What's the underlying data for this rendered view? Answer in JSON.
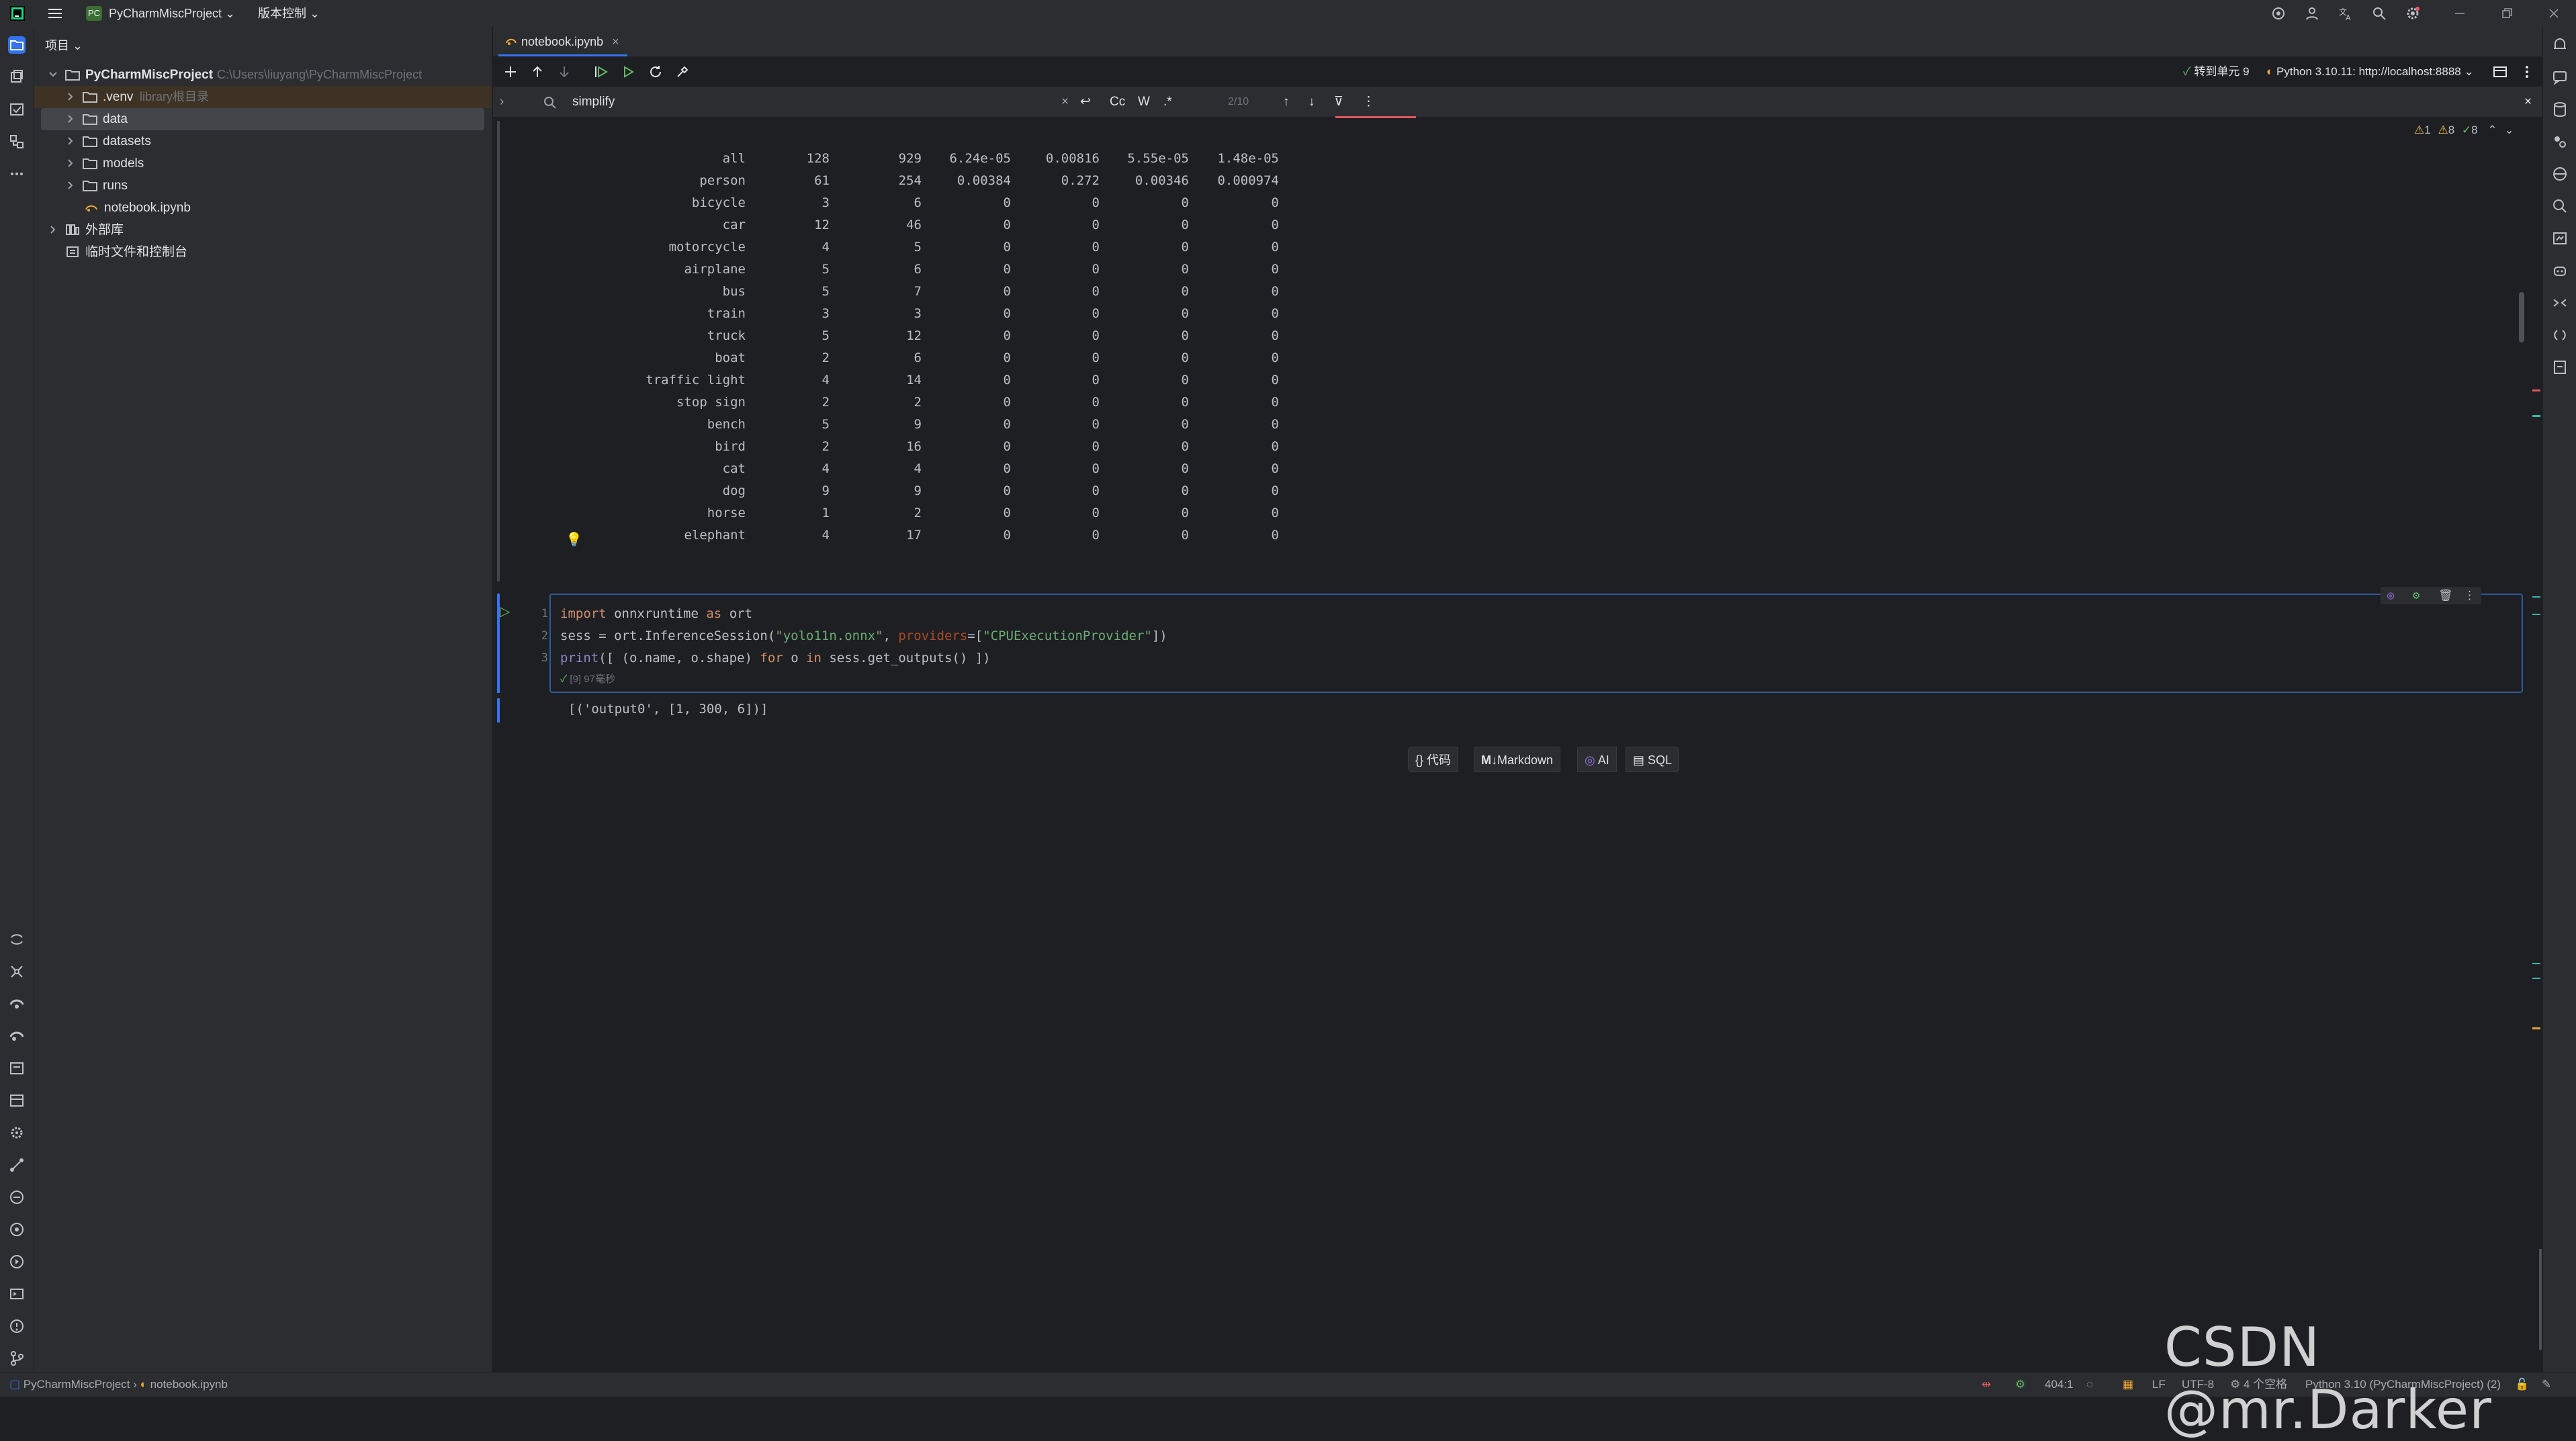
{
  "titlebar": {
    "project_badge": "PC",
    "project_name": "PyCharmMiscProject",
    "vcs_menu": "版本控制"
  },
  "project_panel": {
    "header": "项目",
    "tree": [
      {
        "label": "PyCharmMiscProject",
        "hint": "C:\\Users\\liuyang\\PyCharmMiscProject"
      },
      {
        "label": ".venv",
        "hint": "library根目录"
      },
      {
        "label": "data",
        "hint": ""
      },
      {
        "label": "datasets",
        "hint": ""
      },
      {
        "label": "models",
        "hint": ""
      },
      {
        "label": "runs",
        "hint": ""
      },
      {
        "label": "notebook.ipynb",
        "hint": ""
      },
      {
        "label": "外部库",
        "hint": ""
      },
      {
        "label": "临时文件和控制台",
        "hint": ""
      }
    ]
  },
  "editor": {
    "tab_label": "notebook.ipynb",
    "run_to_cell": "转到单元 9",
    "interpreter": "Python 3.10.11: http://localhost:8888",
    "find": {
      "query": "simplify",
      "case": "Cc",
      "word": "W",
      "regex": ".*",
      "count": "2/10"
    },
    "inspections": {
      "warnings": "1",
      "weak_warnings": "8",
      "ok": "8"
    }
  },
  "output_table": {
    "rows": [
      [
        "all",
        "128",
        "929",
        "6.24e-05",
        "0.00816",
        "5.55e-05",
        "1.48e-05"
      ],
      [
        "person",
        "61",
        "254",
        "0.00384",
        "0.272",
        "0.00346",
        "0.000974"
      ],
      [
        "bicycle",
        "3",
        "6",
        "0",
        "0",
        "0",
        "0"
      ],
      [
        "car",
        "12",
        "46",
        "0",
        "0",
        "0",
        "0"
      ],
      [
        "motorcycle",
        "4",
        "5",
        "0",
        "0",
        "0",
        "0"
      ],
      [
        "airplane",
        "5",
        "6",
        "0",
        "0",
        "0",
        "0"
      ],
      [
        "bus",
        "5",
        "7",
        "0",
        "0",
        "0",
        "0"
      ],
      [
        "train",
        "3",
        "3",
        "0",
        "0",
        "0",
        "0"
      ],
      [
        "truck",
        "5",
        "12",
        "0",
        "0",
        "0",
        "0"
      ],
      [
        "boat",
        "2",
        "6",
        "0",
        "0",
        "0",
        "0"
      ],
      [
        "traffic light",
        "4",
        "14",
        "0",
        "0",
        "0",
        "0"
      ],
      [
        "stop sign",
        "2",
        "2",
        "0",
        "0",
        "0",
        "0"
      ],
      [
        "bench",
        "5",
        "9",
        "0",
        "0",
        "0",
        "0"
      ],
      [
        "bird",
        "2",
        "16",
        "0",
        "0",
        "0",
        "0"
      ],
      [
        "cat",
        "4",
        "4",
        "0",
        "0",
        "0",
        "0"
      ],
      [
        "dog",
        "9",
        "9",
        "0",
        "0",
        "0",
        "0"
      ],
      [
        "horse",
        "1",
        "2",
        "0",
        "0",
        "0",
        "0"
      ],
      [
        "elephant",
        "4",
        "17",
        "0",
        "0",
        "0",
        "0"
      ]
    ]
  },
  "cell": {
    "line_numbers": [
      "1",
      "2",
      "3"
    ],
    "line1": {
      "kw_import": "import",
      "module": " onnxruntime ",
      "kw_as": "as",
      "alias": " ort"
    },
    "line2": {
      "a": "sess = ort.InferenceSession(",
      "str1": "\"yolo11n.onnx\"",
      "b": ", ",
      "param": "providers",
      "c": "=[",
      "str2": "\"CPUExecutionProvider\"",
      "d": "])"
    },
    "line3": {
      "print": "print",
      "a": "([ (o.name, o.shape) ",
      "kw_for": "for",
      "b": " o ",
      "kw_in": "in",
      "c": " sess.get_outputs() ])"
    },
    "exec_info": "[9] 97毫秒",
    "output": "[('output0', [1, 300, 6])]"
  },
  "add_cell": {
    "code": "代码",
    "markdown": "Markdown",
    "ai": "AI",
    "sql": "SQL"
  },
  "statusbar": {
    "breadcrumb_project": "PyCharmMiscProject",
    "breadcrumb_file": "notebook.ipynb",
    "position": "404:1",
    "line_sep": "LF",
    "encoding": "UTF-8",
    "indent": "4 个空格",
    "interpreter": "Python 3.10 (PyCharmMiscProject) (2)"
  },
  "watermark": "CSDN @mr.Darker"
}
